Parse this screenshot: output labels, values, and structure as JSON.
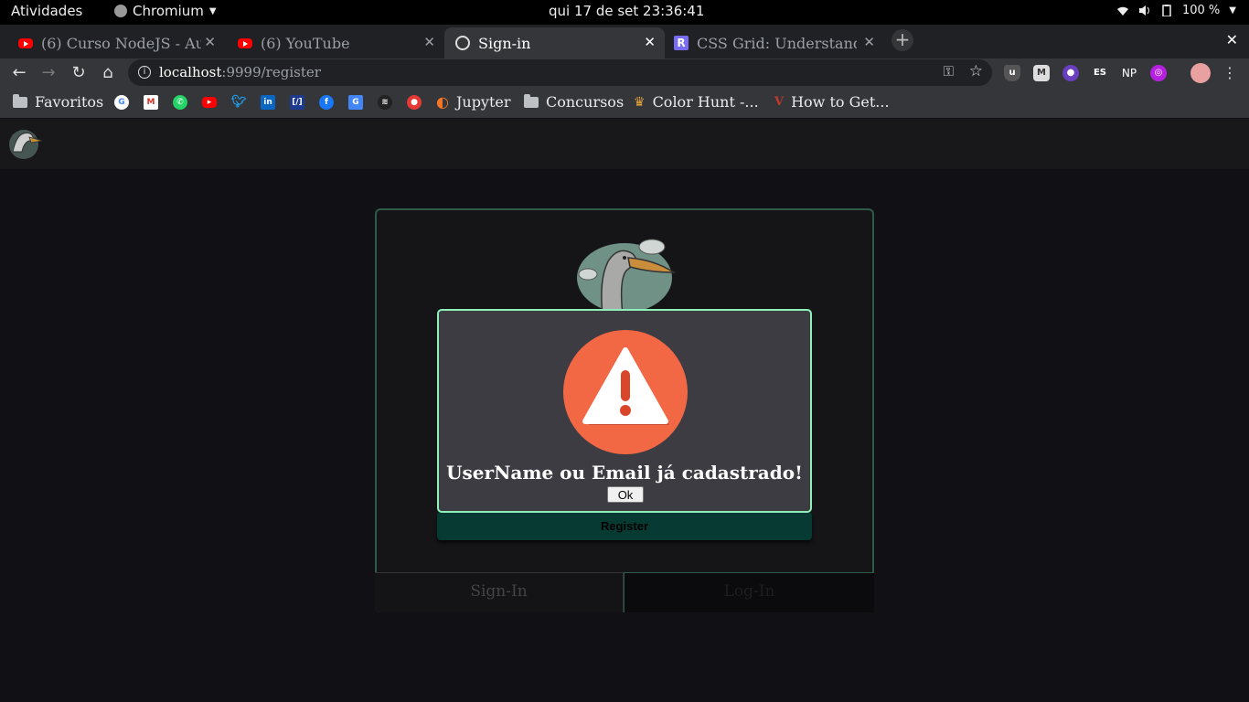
{
  "gnome": {
    "activities": "Atividades",
    "app_name": "Chromium",
    "clock": "qui 17 de set  23:36:41",
    "battery": "100 %"
  },
  "tabs": [
    {
      "title": "(6) Curso NodeJS - Au",
      "icon": "youtube-icon"
    },
    {
      "title": "(6) YouTube",
      "icon": "youtube-icon"
    },
    {
      "title": "Sign-in",
      "icon": "globe-icon"
    },
    {
      "title": "CSS Grid: Understand",
      "icon": "r-logo-icon"
    }
  ],
  "address": {
    "host": "localhost",
    "path": ":9999/register"
  },
  "extensions": {
    "es": "ES",
    "np": "NP"
  },
  "bookmarks": {
    "favoritos": "Favoritos",
    "jupyter": "Jupyter",
    "concursos": "Concursos",
    "colorhunt": "Color Hunt -...",
    "howto": "How to Get..."
  },
  "card": {
    "register_label": "Register",
    "tab_signin": "Sign-In",
    "tab_login": "Log-In"
  },
  "modal": {
    "message": "UserName ou Email já cadastrado!",
    "ok_label": "Ok"
  },
  "colors": {
    "modal_border": "#8ef0b8",
    "warning_circle": "#f26845",
    "card_border": "#2e5a48",
    "register_bg": "#063a33"
  }
}
